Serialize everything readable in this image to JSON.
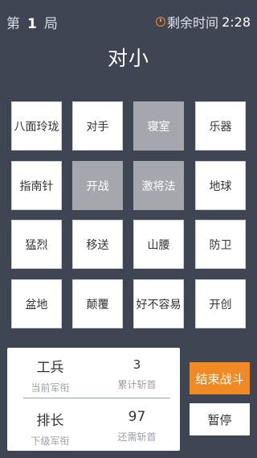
{
  "header": {
    "round_prefix": "第",
    "round_number": "1",
    "round_suffix": "局",
    "timer_icon": "clock-icon",
    "timer_label": "剩余时间",
    "timer_value": "2:28"
  },
  "prompt": {
    "text": "对小"
  },
  "board": {
    "tiles": [
      {
        "label": "八面玲珑",
        "selected": false
      },
      {
        "label": "对手",
        "selected": false
      },
      {
        "label": "寝室",
        "selected": true
      },
      {
        "label": "乐器",
        "selected": false
      },
      {
        "label": "指南针",
        "selected": false
      },
      {
        "label": "开战",
        "selected": true
      },
      {
        "label": "激将法",
        "selected": true
      },
      {
        "label": "地球",
        "selected": false
      },
      {
        "label": "猛烈",
        "selected": false
      },
      {
        "label": "移送",
        "selected": false
      },
      {
        "label": "山腰",
        "selected": false
      },
      {
        "label": "防卫",
        "selected": false
      },
      {
        "label": "盆地",
        "selected": false
      },
      {
        "label": "颠覆",
        "selected": false
      },
      {
        "label": "好不容易",
        "selected": false
      },
      {
        "label": "开创",
        "selected": false
      }
    ]
  },
  "stats": {
    "current_rank_value": "工兵",
    "current_rank_label": "当前军衔",
    "total_kills_value": "3",
    "total_kills_label": "累计斩首",
    "next_rank_value": "排长",
    "next_rank_label": "下级军衔",
    "needed_kills_value": "97",
    "needed_kills_label": "还需斩首"
  },
  "actions": {
    "end_label": "结束战斗",
    "pause_label": "暂停"
  },
  "colors": {
    "background": "#3f4553",
    "accent": "#f08a24",
    "selected_tile": "#a4a7ae"
  }
}
